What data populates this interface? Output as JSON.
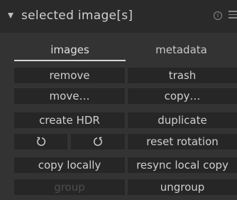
{
  "header": {
    "title": "selected image[s]",
    "info_icon": "ⓘ"
  },
  "tabs": [
    {
      "label": "images",
      "active": true
    },
    {
      "label": "metadata",
      "active": false
    }
  ],
  "buttons": {
    "remove": "remove",
    "trash": "trash",
    "move": "move…",
    "copy": "copy…",
    "create_hdr": "create HDR",
    "duplicate": "duplicate",
    "rotate_left_icon": "rotate-counterclockwise-icon",
    "rotate_right_icon": "rotate-clockwise-icon",
    "reset_rotation": "reset rotation",
    "copy_locally": "copy locally",
    "resync_local_copy": "resync local copy",
    "group": "group",
    "ungroup": "ungroup"
  },
  "states": {
    "group_enabled": false
  },
  "colors": {
    "background": "#333333",
    "header": "#2a2a2a",
    "button": "#262626",
    "text": "#cfcfcf",
    "disabled_text": "#4e4e4e"
  }
}
